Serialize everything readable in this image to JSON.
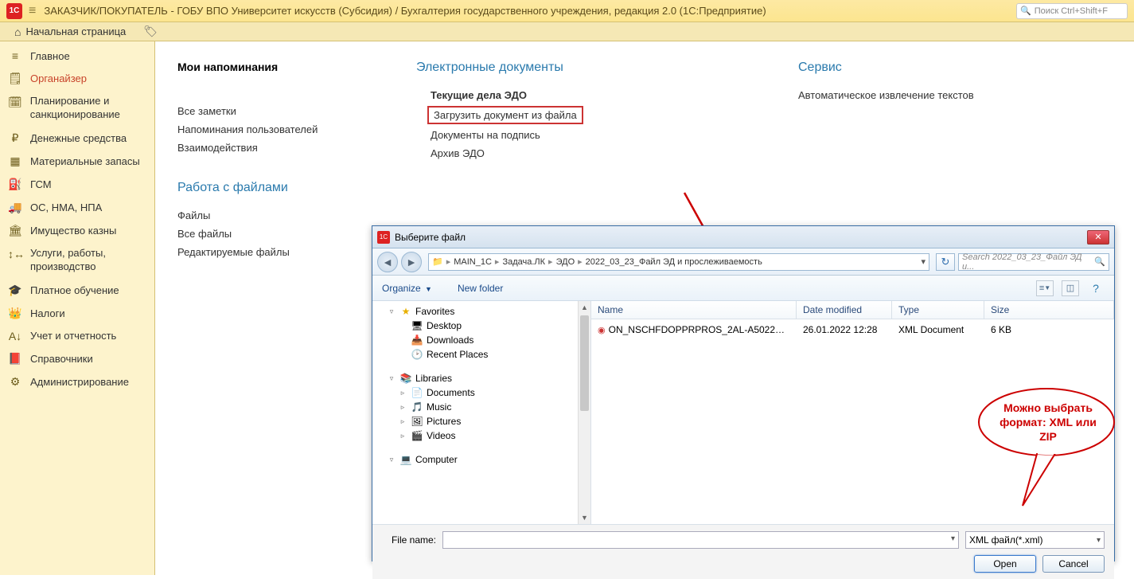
{
  "titlebar": {
    "logo": "1C",
    "title": "ЗАКАЗЧИК/ПОКУПАТЕЛЬ - ГОБУ ВПО Университет искусств (Субсидия) / Бухгалтерия государственного учреждения, редакция 2.0  (1С:Предприятие)",
    "search_placeholder": "Поиск Ctrl+Shift+F"
  },
  "tabbar": {
    "home": "Начальная страница"
  },
  "sidebar": {
    "items": [
      {
        "icon": "≡",
        "label": "Главное"
      },
      {
        "icon": "🗒",
        "label": "Органайзер",
        "active": true
      },
      {
        "icon": "🗓",
        "label": "Планирование и санкционирование"
      },
      {
        "icon": "₽",
        "label": "Денежные средства"
      },
      {
        "icon": "▦",
        "label": "Материальные запасы"
      },
      {
        "icon": "⛽",
        "label": "ГСМ"
      },
      {
        "icon": "🚚",
        "label": "ОС, НМА, НПА"
      },
      {
        "icon": "🏛",
        "label": "Имущество казны"
      },
      {
        "icon": "↕↔",
        "label": "Услуги, работы, производство"
      },
      {
        "icon": "🎓",
        "label": "Платное обучение"
      },
      {
        "icon": "👑",
        "label": "Налоги"
      },
      {
        "icon": "A↓",
        "label": "Учет и отчетность"
      },
      {
        "icon": "📕",
        "label": "Справочники"
      },
      {
        "icon": "⚙",
        "label": "Администрирование"
      }
    ]
  },
  "main": {
    "col1": {
      "title": "Мои напоминания",
      "links": [
        "Все заметки",
        "Напоминания пользователей",
        "Взаимодействия"
      ]
    },
    "col1b": {
      "title": "Работа с файлами",
      "links": [
        "Файлы",
        "Все файлы",
        "Редактируемые файлы"
      ]
    },
    "col2": {
      "title": "Электронные документы",
      "links": [
        {
          "label": "Текущие дела ЭДО",
          "bold": true
        },
        {
          "label": "Загрузить документ из файла",
          "boxed": true
        },
        {
          "label": "Документы на подпись"
        },
        {
          "label": "Архив ЭДО"
        }
      ]
    },
    "col3": {
      "title": "Сервис",
      "links": [
        "Автоматическое извлечение текстов"
      ]
    }
  },
  "dialog": {
    "title": "Выберите файл",
    "breadcrumb": [
      "MAIN_1C",
      "Задача.ЛК",
      "ЭДО",
      "2022_03_23_Файл ЭД и прослеживаемость"
    ],
    "search_placeholder": "Search 2022_03_23_Файл ЭД и...",
    "toolbar": {
      "organize": "Organize",
      "newfolder": "New folder"
    },
    "tree": {
      "favorites": "Favorites",
      "fav_items": [
        "Desktop",
        "Downloads",
        "Recent Places"
      ],
      "libraries": "Libraries",
      "lib_items": [
        "Documents",
        "Music",
        "Pictures",
        "Videos"
      ],
      "computer": "Computer"
    },
    "file_headers": {
      "name": "Name",
      "date": "Date modified",
      "type": "Type",
      "size": "Size"
    },
    "files": [
      {
        "name": "ON_NSCHFDOPPRPROS_2AL-A5022ABE-...",
        "date": "26.01.2022 12:28",
        "type": "XML Document",
        "size": "6 KB"
      }
    ],
    "filename_label": "File name:",
    "filter": "XML файл(*.xml)",
    "open": "Open",
    "cancel": "Cancel"
  },
  "callout": {
    "text": "Можно выбрать формат: XML или ZIP"
  }
}
